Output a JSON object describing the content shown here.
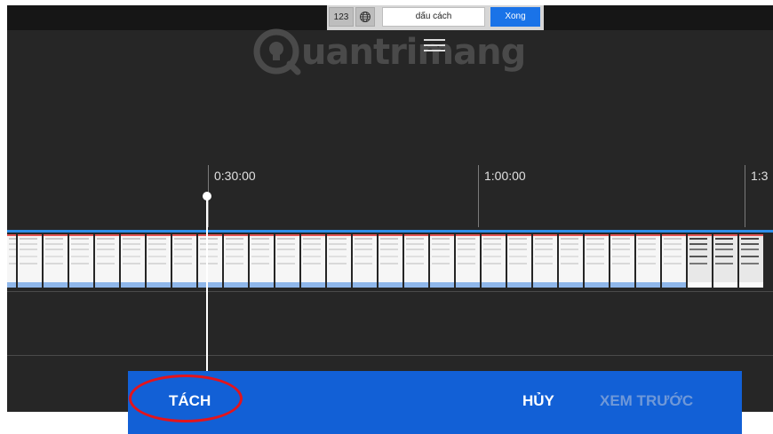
{
  "keyboard": {
    "numbers_key": "123",
    "globe_key_icon": "globe-icon",
    "space_key": "dấu cách",
    "done_key": "Xong"
  },
  "watermark": {
    "text": "uantrimang",
    "logo_icon": "lightbulb-icon"
  },
  "menu_icon": "hamburger-menu-icon",
  "timeline": {
    "marks": [
      "0:30:00",
      "1:00:00",
      "1:3"
    ]
  },
  "actions": {
    "split": "TÁCH",
    "cancel": "HỦY",
    "preview": "XEM TRƯỚC"
  },
  "colors": {
    "accent_blue": "#1260d6",
    "track_line": "#2e8eea",
    "highlight_circle": "#e3141c",
    "background": "#262626"
  }
}
